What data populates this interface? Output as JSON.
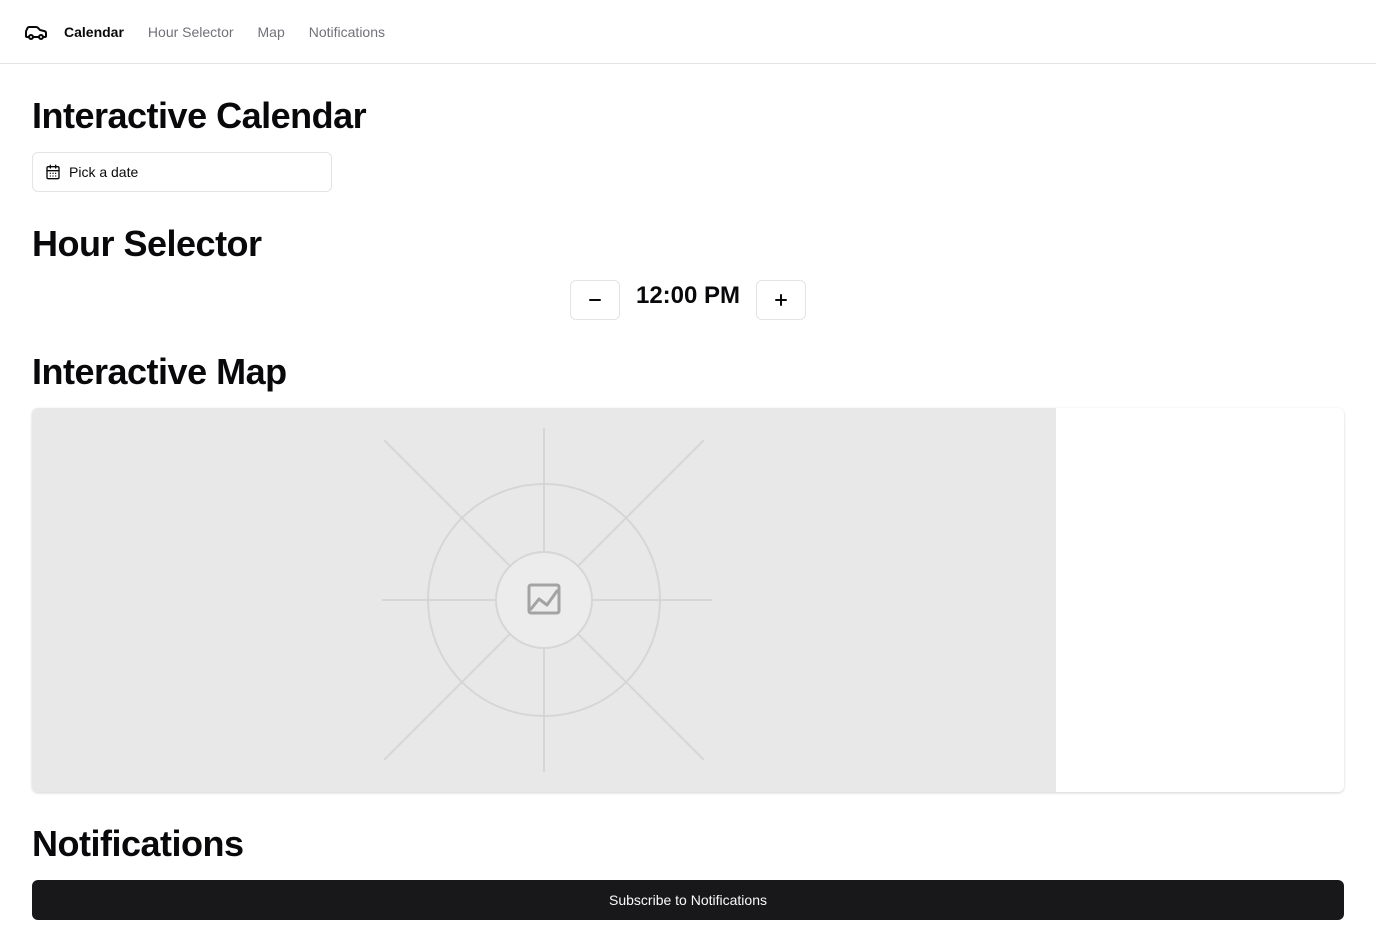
{
  "nav": {
    "logo_icon": "car-icon",
    "items": [
      {
        "label": "Calendar",
        "active": true
      },
      {
        "label": "Hour Selector",
        "active": false
      },
      {
        "label": "Map",
        "active": false
      },
      {
        "label": "Notifications",
        "active": false
      }
    ]
  },
  "calendar": {
    "title": "Interactive Calendar",
    "picker_label": "Pick a date",
    "picker_icon": "calendar-icon"
  },
  "hour_selector": {
    "title": "Hour Selector",
    "decrement_label": "−",
    "increment_label": "+",
    "time": "12:00 PM"
  },
  "map": {
    "title": "Interactive Map",
    "placeholder_icon": "image-placeholder-icon",
    "placeholder_color": "#e8e8e8"
  },
  "notifications": {
    "title": "Notifications",
    "subscribe_label": "Subscribe to Notifications",
    "button_color": "#18181b"
  }
}
